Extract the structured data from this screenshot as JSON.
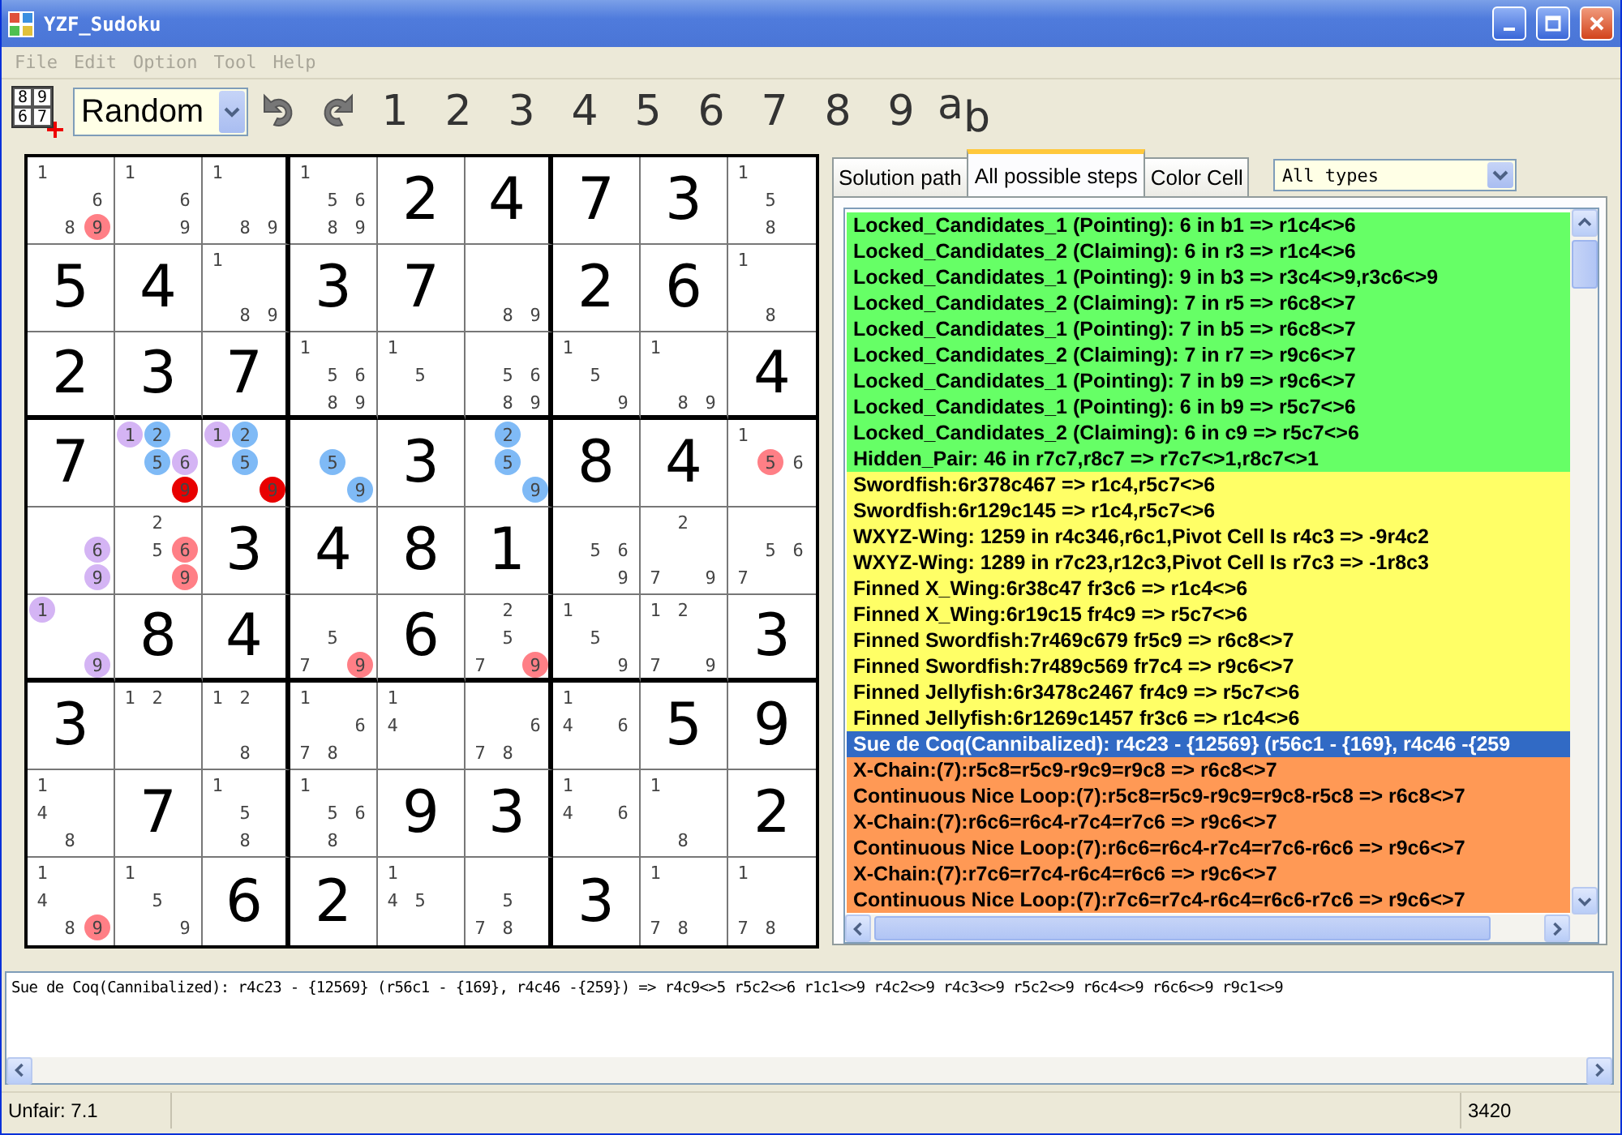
{
  "window": {
    "title": "YZF_Sudoku"
  },
  "menu": [
    {
      "label": "File",
      "disabled": true
    },
    {
      "label": "Edit",
      "disabled": true
    },
    {
      "label": "Option",
      "disabled": true
    },
    {
      "label": "Tool",
      "disabled": true
    },
    {
      "label": "Help",
      "disabled": true
    }
  ],
  "toolbar": {
    "new_puzzle_digits": [
      "8",
      "9",
      "6",
      "7"
    ],
    "mode": "Random",
    "digits": [
      "1",
      "2",
      "3",
      "4",
      "5",
      "6",
      "7",
      "8",
      "9"
    ],
    "letters": "a$_{b}$"
  },
  "grid": [
    [
      {
        "candidates": [
          {
            "digit": "1"
          },
          {
            "digit": "6"
          },
          {
            "digit": "8"
          },
          {
            "digit": "9",
            "color": "#ff7f86"
          }
        ]
      },
      {
        "candidates": [
          {
            "digit": "1"
          },
          {
            "digit": "6"
          },
          {
            "digit": "9"
          }
        ]
      },
      {
        "candidates": [
          {
            "digit": "1"
          },
          {
            "digit": "8"
          },
          {
            "digit": "9"
          }
        ]
      },
      {
        "candidates": [
          {
            "digit": "1"
          },
          {
            "digit": "5"
          },
          {
            "digit": "6"
          },
          {
            "digit": "8"
          },
          {
            "digit": "9"
          }
        ]
      },
      {
        "value": "2"
      },
      {
        "value": "4"
      },
      {
        "value": "7"
      },
      {
        "value": "3"
      },
      {
        "candidates": [
          {
            "digit": "1"
          },
          {
            "digit": "5"
          },
          {
            "digit": "8"
          }
        ]
      }
    ],
    [
      {
        "value": "5"
      },
      {
        "value": "4"
      },
      {
        "candidates": [
          {
            "digit": "1"
          },
          {
            "digit": "8"
          },
          {
            "digit": "9"
          }
        ]
      },
      {
        "value": "3"
      },
      {
        "value": "7"
      },
      {
        "candidates": [
          {
            "digit": "8"
          },
          {
            "digit": "9"
          }
        ]
      },
      {
        "value": "2"
      },
      {
        "value": "6"
      },
      {
        "candidates": [
          {
            "digit": "1"
          },
          {
            "digit": "8"
          }
        ]
      }
    ],
    [
      {
        "value": "2"
      },
      {
        "value": "3"
      },
      {
        "value": "7"
      },
      {
        "candidates": [
          {
            "digit": "1"
          },
          {
            "digit": "5"
          },
          {
            "digit": "6"
          },
          {
            "digit": "8"
          },
          {
            "digit": "9"
          }
        ]
      },
      {
        "candidates": [
          {
            "digit": "1"
          },
          {
            "digit": "5"
          }
        ]
      },
      {
        "candidates": [
          {
            "digit": "5"
          },
          {
            "digit": "6"
          },
          {
            "digit": "8"
          },
          {
            "digit": "9"
          }
        ]
      },
      {
        "candidates": [
          {
            "digit": "1"
          },
          {
            "digit": "5"
          },
          {
            "digit": "9"
          }
        ]
      },
      {
        "candidates": [
          {
            "digit": "1"
          },
          {
            "digit": "8"
          },
          {
            "digit": "9"
          }
        ]
      },
      {
        "value": "4"
      }
    ],
    [
      {
        "value": "7"
      },
      {
        "candidates": [
          {
            "digit": "1",
            "color": "#d4b4f4"
          },
          {
            "digit": "2",
            "color": "#7fbaf6"
          },
          {
            "digit": "5",
            "color": "#7fbaf6"
          },
          {
            "digit": "6",
            "color": "#d4b4f4"
          },
          {
            "digit": "9",
            "color": "#e80000"
          }
        ]
      },
      {
        "candidates": [
          {
            "digit": "1",
            "color": "#d4b4f4"
          },
          {
            "digit": "2",
            "color": "#7fbaf6"
          },
          {
            "digit": "5",
            "color": "#7fbaf6"
          },
          {
            "digit": "9",
            "color": "#e80000"
          }
        ]
      },
      {
        "candidates": [
          {
            "digit": "5",
            "color": "#7fbaf6"
          },
          {
            "digit": "9",
            "color": "#7fbaf6"
          }
        ]
      },
      {
        "value": "3"
      },
      {
        "candidates": [
          {
            "digit": "2",
            "color": "#7fbaf6"
          },
          {
            "digit": "5",
            "color": "#7fbaf6"
          },
          {
            "digit": "9",
            "color": "#7fbaf6"
          }
        ]
      },
      {
        "value": "8"
      },
      {
        "value": "4"
      },
      {
        "candidates": [
          {
            "digit": "1"
          },
          {
            "digit": "5",
            "color": "#ff7f86"
          },
          {
            "digit": "6"
          }
        ]
      }
    ],
    [
      {
        "candidates": [
          {
            "digit": "6",
            "color": "#d4b4f4"
          },
          {
            "digit": "9",
            "color": "#d4b4f4"
          }
        ]
      },
      {
        "candidates": [
          {
            "digit": "2"
          },
          {
            "digit": "5"
          },
          {
            "digit": "6",
            "color": "#ff7f86"
          },
          {
            "digit": "9",
            "color": "#ff7f86"
          }
        ]
      },
      {
        "value": "3"
      },
      {
        "value": "4"
      },
      {
        "value": "8"
      },
      {
        "value": "1"
      },
      {
        "candidates": [
          {
            "digit": "5"
          },
          {
            "digit": "6"
          },
          {
            "digit": "9"
          }
        ]
      },
      {
        "candidates": [
          {
            "digit": "2"
          },
          {
            "digit": "7"
          },
          {
            "digit": "9"
          }
        ]
      },
      {
        "candidates": [
          {
            "digit": "5"
          },
          {
            "digit": "6"
          },
          {
            "digit": "7"
          }
        ]
      }
    ],
    [
      {
        "candidates": [
          {
            "digit": "1",
            "color": "#d4b4f4"
          },
          {
            "digit": "9",
            "color": "#d4b4f4"
          }
        ]
      },
      {
        "value": "8"
      },
      {
        "value": "4"
      },
      {
        "candidates": [
          {
            "digit": "5"
          },
          {
            "digit": "7"
          },
          {
            "digit": "9",
            "color": "#ff7f86"
          }
        ]
      },
      {
        "value": "6"
      },
      {
        "candidates": [
          {
            "digit": "2"
          },
          {
            "digit": "5"
          },
          {
            "digit": "7"
          },
          {
            "digit": "9",
            "color": "#ff7f86"
          }
        ]
      },
      {
        "candidates": [
          {
            "digit": "1"
          },
          {
            "digit": "5"
          },
          {
            "digit": "9"
          }
        ]
      },
      {
        "candidates": [
          {
            "digit": "1"
          },
          {
            "digit": "2"
          },
          {
            "digit": "7"
          },
          {
            "digit": "9"
          }
        ]
      },
      {
        "value": "3"
      }
    ],
    [
      {
        "value": "3"
      },
      {
        "candidates": [
          {
            "digit": "1"
          },
          {
            "digit": "2"
          }
        ]
      },
      {
        "candidates": [
          {
            "digit": "1"
          },
          {
            "digit": "2"
          },
          {
            "digit": "8"
          }
        ]
      },
      {
        "candidates": [
          {
            "digit": "1"
          },
          {
            "digit": "6"
          },
          {
            "digit": "7"
          },
          {
            "digit": "8"
          }
        ]
      },
      {
        "candidates": [
          {
            "digit": "1"
          },
          {
            "digit": "4"
          }
        ]
      },
      {
        "candidates": [
          {
            "digit": "6"
          },
          {
            "digit": "7"
          },
          {
            "digit": "8"
          }
        ]
      },
      {
        "candidates": [
          {
            "digit": "1"
          },
          {
            "digit": "4"
          },
          {
            "digit": "6"
          }
        ]
      },
      {
        "value": "5"
      },
      {
        "value": "9"
      }
    ],
    [
      {
        "candidates": [
          {
            "digit": "1"
          },
          {
            "digit": "4"
          },
          {
            "digit": "8"
          }
        ]
      },
      {
        "value": "7"
      },
      {
        "candidates": [
          {
            "digit": "1"
          },
          {
            "digit": "5"
          },
          {
            "digit": "8"
          }
        ]
      },
      {
        "candidates": [
          {
            "digit": "1"
          },
          {
            "digit": "5"
          },
          {
            "digit": "6"
          },
          {
            "digit": "8"
          }
        ]
      },
      {
        "value": "9"
      },
      {
        "value": "3"
      },
      {
        "candidates": [
          {
            "digit": "1"
          },
          {
            "digit": "4"
          },
          {
            "digit": "6"
          }
        ]
      },
      {
        "candidates": [
          {
            "digit": "1"
          },
          {
            "digit": "8"
          }
        ]
      },
      {
        "value": "2"
      }
    ],
    [
      {
        "candidates": [
          {
            "digit": "1"
          },
          {
            "digit": "4"
          },
          {
            "digit": "8"
          },
          {
            "digit": "9",
            "color": "#ff7f86"
          }
        ]
      },
      {
        "candidates": [
          {
            "digit": "1"
          },
          {
            "digit": "5"
          },
          {
            "digit": "9"
          }
        ]
      },
      {
        "value": "6"
      },
      {
        "value": "2"
      },
      {
        "candidates": [
          {
            "digit": "1"
          },
          {
            "digit": "4"
          },
          {
            "digit": "5"
          }
        ]
      },
      {
        "candidates": [
          {
            "digit": "5"
          },
          {
            "digit": "7"
          },
          {
            "digit": "8"
          }
        ]
      },
      {
        "value": "3"
      },
      {
        "candidates": [
          {
            "digit": "1"
          },
          {
            "digit": "7"
          },
          {
            "digit": "8"
          }
        ]
      },
      {
        "candidates": [
          {
            "digit": "1"
          },
          {
            "digit": "7"
          },
          {
            "digit": "8"
          }
        ]
      }
    ]
  ],
  "tabs": [
    {
      "label": "Solution path",
      "selected": false
    },
    {
      "label": "All possible steps",
      "selected": true
    },
    {
      "label": "Color Cell",
      "selected": false
    }
  ],
  "filter": "All types",
  "steps": [
    {
      "text": "Locked_Candidates_1 (Pointing): 6 in b1 => r1c4<>6",
      "color": "#66ff66",
      "selected": false
    },
    {
      "text": "Locked_Candidates_2 (Claiming): 6 in r3 => r1c4<>6",
      "color": "#66ff66",
      "selected": false
    },
    {
      "text": "Locked_Candidates_1 (Pointing): 9 in b3 => r3c4<>9,r3c6<>9",
      "color": "#66ff66",
      "selected": false
    },
    {
      "text": "Locked_Candidates_2 (Claiming): 7 in r5 => r6c8<>7",
      "color": "#66ff66",
      "selected": false
    },
    {
      "text": "Locked_Candidates_1 (Pointing): 7 in b5 => r6c8<>7",
      "color": "#66ff66",
      "selected": false
    },
    {
      "text": "Locked_Candidates_2 (Claiming): 7 in r7 => r9c6<>7",
      "color": "#66ff66",
      "selected": false
    },
    {
      "text": "Locked_Candidates_1 (Pointing): 7 in b9 => r9c6<>7",
      "color": "#66ff66",
      "selected": false
    },
    {
      "text": "Locked_Candidates_1 (Pointing): 6 in b9 => r5c7<>6",
      "color": "#66ff66",
      "selected": false
    },
    {
      "text": "Locked_Candidates_2 (Claiming): 6 in c9 => r5c7<>6",
      "color": "#66ff66",
      "selected": false
    },
    {
      "text": "Hidden_Pair: 46 in r7c7,r8c7 => r7c7<>1,r8c7<>1",
      "color": "#66ff66",
      "selected": false
    },
    {
      "text": "Swordfish:6r378c467  => r1c4,r5c7<>6",
      "color": "#ffff66",
      "selected": false
    },
    {
      "text": "Swordfish:6r129c145  => r1c4,r5c7<>6",
      "color": "#ffff66",
      "selected": false
    },
    {
      "text": "WXYZ-Wing: 1259 in r4c346,r6c1,Pivot Cell Is r4c3 => -9r4c2",
      "color": "#ffff66",
      "selected": false
    },
    {
      "text": "WXYZ-Wing: 1289 in r7c23,r12c3,Pivot Cell Is r7c3 => -1r8c3",
      "color": "#ffff66",
      "selected": false
    },
    {
      "text": "Finned X_Wing:6r38c47 fr3c6 => r1c4<>6",
      "color": "#ffff66",
      "selected": false
    },
    {
      "text": "Finned X_Wing:6r19c15 fr4c9 => r5c7<>6",
      "color": "#ffff66",
      "selected": false
    },
    {
      "text": "Finned Swordfish:7r469c679 fr5c9 => r6c8<>7",
      "color": "#ffff66",
      "selected": false
    },
    {
      "text": "Finned Swordfish:7r489c569 fr7c4 => r9c6<>7",
      "color": "#ffff66",
      "selected": false
    },
    {
      "text": "Finned Jellyfish:6r3478c2467 fr4c9 => r5c7<>6",
      "color": "#ffff66",
      "selected": false
    },
    {
      "text": "Finned Jellyfish:6r1269c1457 fr3c6 => r1c4<>6",
      "color": "#ffff66",
      "selected": false
    },
    {
      "text": "Sue de Coq(Cannibalized): r4c23 - {12569} (r56c1 - {169}, r4c46 -{259",
      "selected": true
    },
    {
      "text": "X-Chain:(7):r5c8=r5c9-r9c9=r9c8 => r6c8<>7",
      "color": "#ff9955",
      "selected": false
    },
    {
      "text": "Continuous Nice Loop:(7):r5c8=r5c9-r9c9=r9c8-r5c8 => r6c8<>7",
      "color": "#ff9955",
      "selected": false
    },
    {
      "text": "X-Chain:(7):r6c6=r6c4-r7c4=r7c6 => r9c6<>7",
      "color": "#ff9955",
      "selected": false
    },
    {
      "text": "Continuous Nice Loop:(7):r6c6=r6c4-r7c4=r7c6-r6c6 => r9c6<>7",
      "color": "#ff9955",
      "selected": false
    },
    {
      "text": "X-Chain:(7):r7c6=r7c4-r6c4=r6c6 => r9c6<>7",
      "color": "#ff9955",
      "selected": false
    },
    {
      "text": "Continuous Nice Loop:(7):r7c6=r7c4-r6c4=r6c6-r7c6 => r9c6<>7",
      "color": "#ff9955",
      "selected": false
    }
  ],
  "details": "Sue de Coq(Cannibalized): r4c23 - {12569} (r56c1 - {169}, r4c46 -{259}) =>  r4c9<>5 r5c2<>6 r1c1<>9 r4c2<>9 r4c3<>9 r5c2<>9 r6c4<>9 r6c6<>9 r9c1<>9",
  "status": {
    "rating": "Unfair: 7.1",
    "count": "3420"
  }
}
